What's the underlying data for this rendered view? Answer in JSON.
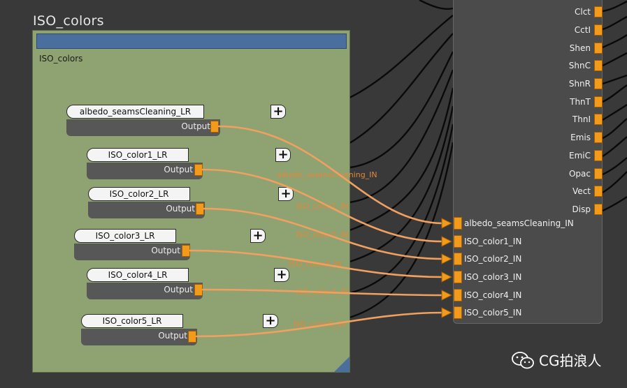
{
  "network": {
    "title": "ISO_colors",
    "label": "ISO_colors"
  },
  "nodes": [
    {
      "name": "albedo_seamsCleaning_LR",
      "output": "Output"
    },
    {
      "name": "ISO_color1_LR",
      "output": "Output"
    },
    {
      "name": "ISO_color2_LR",
      "output": "Output"
    },
    {
      "name": "ISO_color3_LR",
      "output": "Output"
    },
    {
      "name": "ISO_color4_LR",
      "output": "Output"
    },
    {
      "name": "ISO_color5_LR",
      "output": "Output"
    }
  ],
  "plus_glyph": "+",
  "material": {
    "existing_inputs": [
      "Clct",
      "CctI",
      "Shen",
      "ShnC",
      "ShnR",
      "ThnT",
      "ThnI",
      "Emis",
      "EmiC",
      "Opac",
      "Vect",
      "Disp"
    ],
    "new_inputs": [
      "albedo_seamsCleaning_IN",
      "ISO_color1_IN",
      "ISO_color2_IN",
      "ISO_color3_IN",
      "ISO_color4_IN",
      "ISO_color5_IN"
    ]
  },
  "wire_labels": [
    "albedo_seamsCleaning_IN",
    "ISO_color1_IN",
    "ISO_color2_IN",
    "ISO_color3_IN",
    "ISO_color4_IN",
    "ISO_color5_IN"
  ],
  "watermark": {
    "text": "CG拍浪人",
    "icon": "wechat-icon"
  },
  "colors": {
    "background": "#393939",
    "network_box": "#8fa372",
    "title_bar": "#4a6f9e",
    "port": "#f19a1c",
    "wire_highlight": "#f0a060",
    "wire_dark": "#0a0a0a",
    "node_body": "#575757",
    "material_node": "#4b4b4b"
  }
}
